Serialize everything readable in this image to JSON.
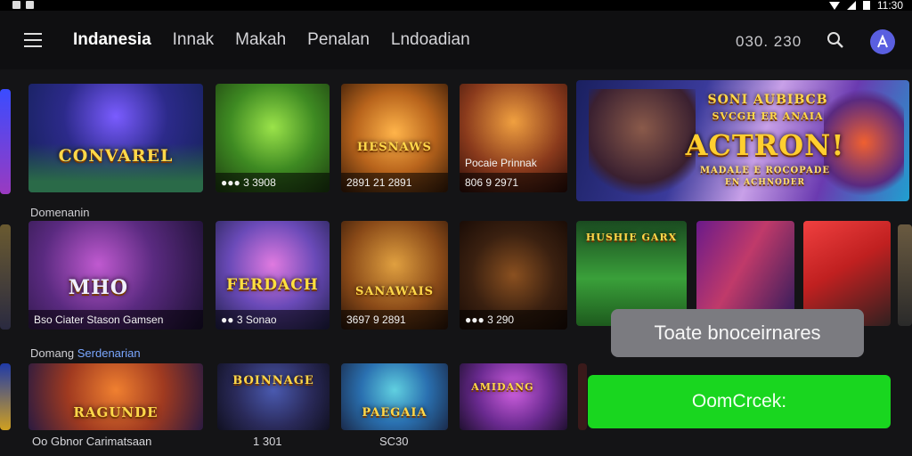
{
  "status_bar": {
    "time": "11:30"
  },
  "nav": {
    "tabs": [
      {
        "label": "Indanesia",
        "active": true
      },
      {
        "label": "Innak",
        "active": false
      },
      {
        "label": "Makah",
        "active": false
      },
      {
        "label": "Penalan",
        "active": false
      },
      {
        "label": "Lndoadian",
        "active": false
      }
    ],
    "coins": "030. 230",
    "icons": [
      "menu-icon",
      "search-icon",
      "avatar-icon"
    ]
  },
  "rows": {
    "row1": [
      {
        "logo": "CONVAREL",
        "caption": ""
      },
      {
        "logo": "",
        "caption": "●●● 3 3908"
      },
      {
        "logo": "HESNAWS",
        "caption": "2891 21 2891"
      },
      {
        "logo": "",
        "caption": "Pocaie Prinnak"
      },
      {
        "logo": "",
        "caption": "806 9 2971"
      }
    ],
    "banner": {
      "line1": "SONI AUBIBCB",
      "line2": "SVCGH ER ANAIA",
      "big": "ACTRON!",
      "sub": "MADALE E ROCOPADE",
      "small": "EN ACHNODER"
    },
    "section2_label": "Domenanin",
    "row2": [
      {
        "logo": "MHO",
        "caption": "Bso Ciater Stason Gamsen"
      },
      {
        "logo": "FERDACH",
        "caption": "●● 3 Sonao"
      },
      {
        "logo": "SANAWAIS",
        "caption": "3697 9 2891"
      },
      {
        "logo": "",
        "caption": "●●● 3 290"
      },
      {
        "logo": "HUSHIE GARX",
        "caption": ""
      }
    ],
    "section3_label_a": "Domang",
    "section3_label_b": "Serdenarian",
    "row3": [
      {
        "logo": "RAGUNDE",
        "caption": "Oo Gbnor Carimatsaan"
      },
      {
        "logo": "BOINNAGE",
        "caption": "1 301"
      },
      {
        "logo": "PAEGAIA",
        "caption": "SC30"
      },
      {
        "logo": "AMIDANG",
        "caption": ""
      }
    ]
  },
  "toast": {
    "text": "Toate bnoceirnares"
  },
  "cta": {
    "label": "OomCrcek:"
  },
  "colors": {
    "background": "#141416",
    "cta": "#19d61f",
    "toast": "#7b7b80",
    "accent": "#5a5fe0",
    "logo": "#ffd84a"
  }
}
